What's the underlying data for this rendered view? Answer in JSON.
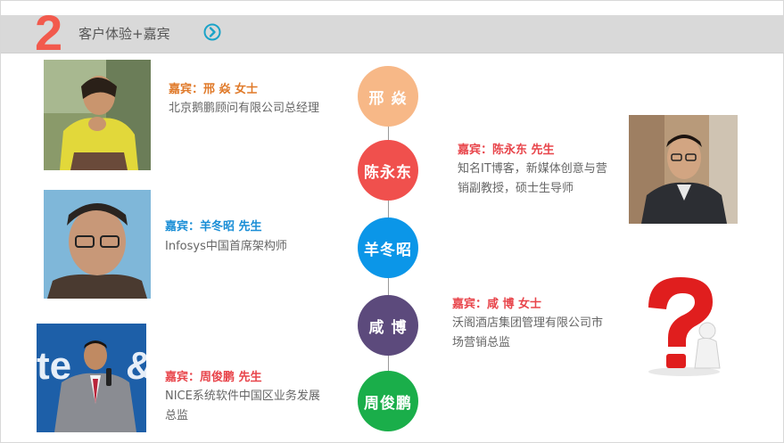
{
  "header": {
    "number": "2",
    "title": "客户体验+嘉宾"
  },
  "colors": {
    "accent_red": "#f25a4d",
    "peach": "#f7b887",
    "red": "#f0504d",
    "blue": "#0b96e8",
    "purple": "#5c4a7c",
    "green": "#1aae4a",
    "name_orange": "#e07a2a",
    "name_red": "#e8454b",
    "name_blue": "#1a8ed6"
  },
  "guests": [
    {
      "circle_label": "邢 焱",
      "title_line": "嘉宾：邢  焱 女士",
      "desc": "北京鹅鹏顾问有限公司总经理"
    },
    {
      "circle_label": "陈永东",
      "title_line": "嘉宾：陈永东 先生",
      "desc": "知名IT博客，新媒体创意与营销副教授，硕士生导师"
    },
    {
      "circle_label": "羊冬昭",
      "title_line": "嘉宾：羊冬昭 先生",
      "desc": "Infosys中国首席架构师"
    },
    {
      "circle_label": "咸 博",
      "title_line": "嘉宾：咸  博 女士",
      "desc": "沃阁酒店集团管理有限公司市场营销总监"
    },
    {
      "circle_label": "周俊鹏",
      "title_line": "嘉宾：周俊鹏 先生",
      "desc": "NICE系统软件中国区业务发展总监"
    }
  ]
}
